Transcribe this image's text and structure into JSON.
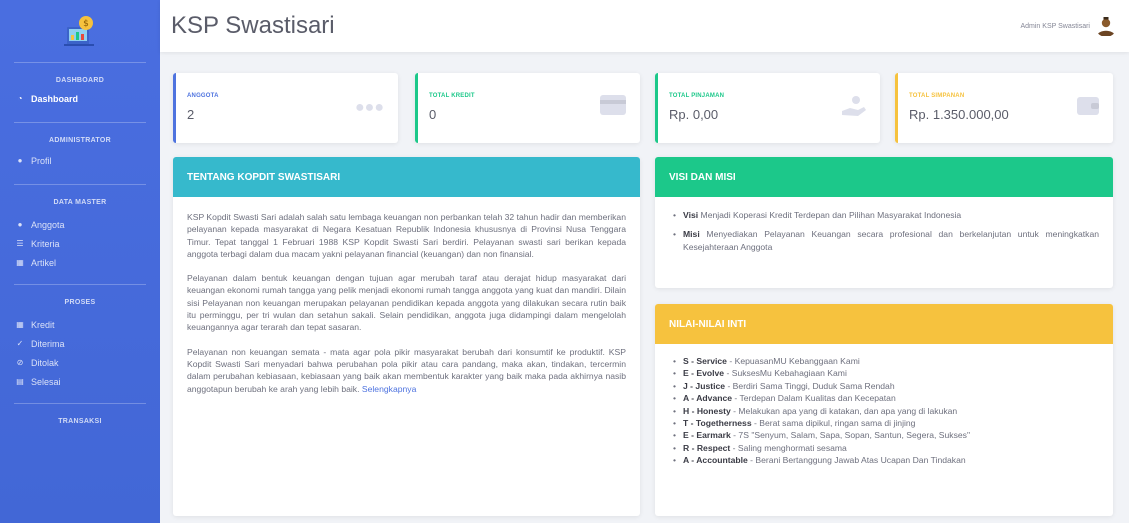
{
  "app": {
    "title": "KSP Swastisari"
  },
  "user": {
    "name": "Admin KSP Swastisari"
  },
  "colors": {
    "primary": "#4e73df",
    "success": "#1cc88a",
    "info": "#36b9cc",
    "warning": "#f6c23e"
  },
  "sidebar": {
    "sections": [
      {
        "heading": "DASHBOARD",
        "items": [
          {
            "label": "Dashboard",
            "icon": "tachometer-icon",
            "active": true
          }
        ]
      },
      {
        "heading": "ADMINISTRATOR",
        "items": [
          {
            "label": "Profil",
            "icon": "user-icon"
          }
        ]
      },
      {
        "heading": "DATA MASTER",
        "items": [
          {
            "label": "Anggota",
            "icon": "users-icon"
          },
          {
            "label": "Kriteria",
            "icon": "list-icon"
          },
          {
            "label": "Artikel",
            "icon": "table-icon"
          }
        ]
      },
      {
        "heading": "PROSES",
        "items": [
          {
            "label": "Kredit",
            "icon": "table-icon"
          },
          {
            "label": "Diterima",
            "icon": "user-check-icon"
          },
          {
            "label": "Ditolak",
            "icon": "ban-icon"
          },
          {
            "label": "Selesai",
            "icon": "file-icon"
          }
        ]
      },
      {
        "heading": "TRANSAKSI",
        "items": []
      }
    ]
  },
  "stats": [
    {
      "label": "ANGGOTA",
      "value": "2",
      "icon": "users-icon",
      "color": "#4e73df"
    },
    {
      "label": "TOTAL KREDIT",
      "value": "0",
      "icon": "credit-card-icon",
      "color": "#1cc88a"
    },
    {
      "label": "TOTAL PINJAMAN",
      "value": "Rp. 0,00",
      "icon": "hand-money-icon",
      "color": "#1cc88a"
    },
    {
      "label": "TOTAL SIMPANAN",
      "value": "Rp. 1.350.000,00",
      "icon": "wallet-icon",
      "color": "#f6c23e"
    }
  ],
  "about": {
    "title": "TENTANG KOPDIT SWASTISARI",
    "paragraphs": [
      "KSP Kopdit Swasti Sari adalah salah satu lembaga keuangan non perbankan telah 32 tahun hadir dan memberikan pelayanan kepada masyarakat di Negara Kesatuan Republik Indonesia khususnya di Provinsi Nusa Tenggara Timur. Tepat tanggal 1 Februari 1988 KSP Kopdit Swasti Sari berdiri. Pelayanan swasti sari berikan kepada anggota terbagi dalam dua macam yakni pelayanan financial (keuangan) dan non finansial.",
      "Pelayanan dalam bentuk keuangan dengan tujuan agar merubah taraf atau derajat hidup masyarakat dari keuangan ekonomi rumah tangga yang pelik menjadi ekonomi rumah tangga anggota yang kuat dan mandiri. Dilain sisi Pelayanan non keuangan merupakan pelayanan pendidikan kepada anggota yang dilakukan secara rutin baik itu perminggu, per tri wulan dan setahun sakali. Selain pendidikan, anggota juga didampingi dalam mengelolah keuangannya agar terarah dan tepat sasaran.",
      "Pelayanan non keuangan semata - mata agar pola pikir masyarakat berubah dari konsumtif ke produktif. KSP Kopdit Swasti Sari menyadari bahwa perubahan pola pikir atau cara pandang, maka akan, tindakan, tercermin dalam perubahan kebiasaan, kebiasaan yang baik akan membentuk karakter yang baik maka pada akhirnya nasib anggotapun berubah ke arah yang lebih baik."
    ],
    "more_link": "Selengkapnya"
  },
  "visi_misi": {
    "title": "VISI DAN MISI",
    "items": [
      {
        "key": "Visi",
        "text": "Menjadi Koperasi Kredit Terdepan dan Pilihan Masyarakat Indonesia"
      },
      {
        "key": "Misi",
        "text": "Menyediakan Pelayanan Keuangan secara profesional dan berkelanjutan untuk meningkatkan Kesejahteraan Anggota"
      }
    ]
  },
  "nilai": {
    "title": "NILAI-NILAI INTI",
    "items": [
      {
        "key": "S - Service",
        "text": "- KepuasanMU Kebanggaan Kami"
      },
      {
        "key": "E - Evolve",
        "text": "- SuksesMu Kebahagiaan Kami"
      },
      {
        "key": "J - Justice",
        "text": "- Berdiri Sama Tinggi, Duduk Sama Rendah"
      },
      {
        "key": "A - Advance",
        "text": "- Terdepan Dalam Kualitas dan Kecepatan"
      },
      {
        "key": "H - Honesty",
        "text": "- Melakukan apa yang di katakan, dan apa yang di lakukan"
      },
      {
        "key": "T - Togetherness",
        "text": "- Berat sama dipikul, ringan sama di jinjing"
      },
      {
        "key": "E - Earmark",
        "text": "- 7S \"Senyum, Salam, Sapa, Sopan, Santun, Segera, Sukses\""
      },
      {
        "key": "R - Respect",
        "text": "- Saling menghormati sesama"
      },
      {
        "key": "A - Accountable",
        "text": "- Berani Bertanggung Jawab Atas Ucapan Dan Tindakan"
      }
    ]
  }
}
